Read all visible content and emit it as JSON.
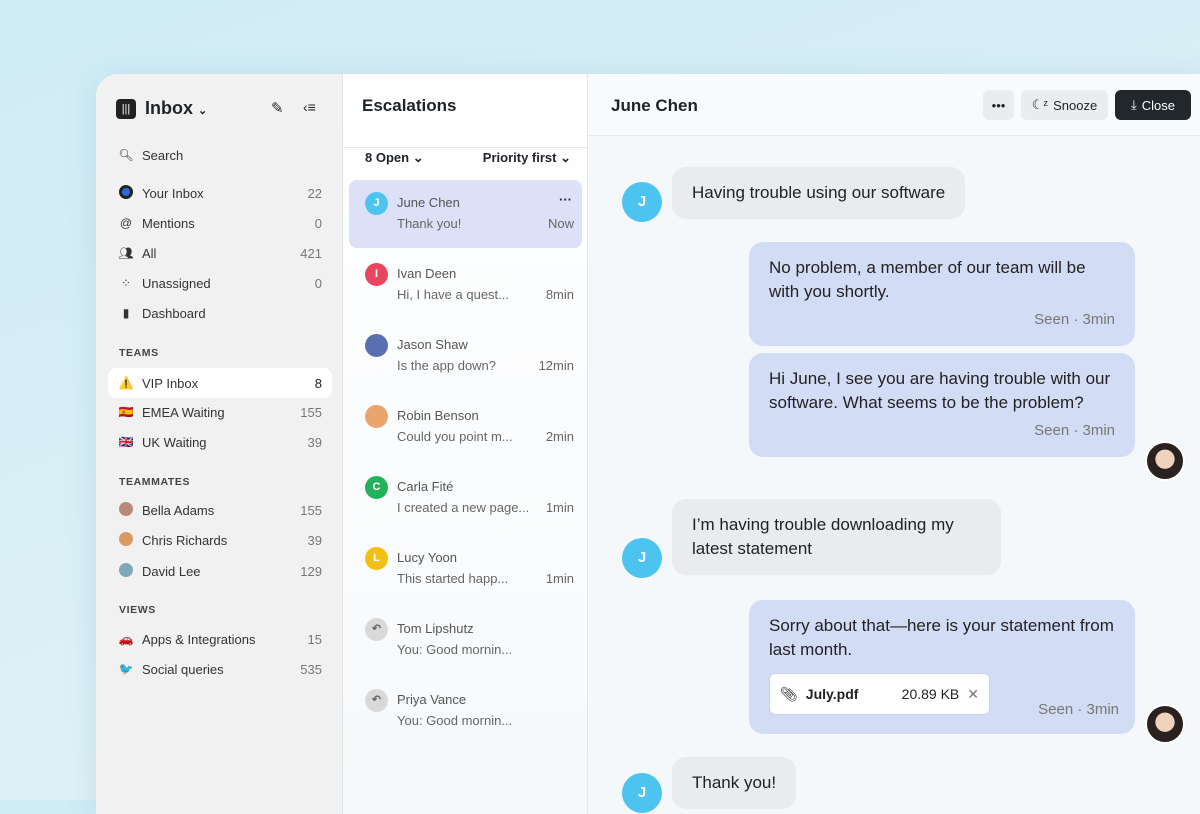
{
  "sidebar": {
    "title": "Inbox",
    "search": "Search",
    "items": [
      {
        "label": "Your Inbox",
        "count": "22"
      },
      {
        "label": "Mentions",
        "count": "0"
      },
      {
        "label": "All",
        "count": "421"
      },
      {
        "label": "Unassigned",
        "count": "0"
      },
      {
        "label": "Dashboard",
        "count": ""
      }
    ],
    "teams_heading": "TEAMS",
    "teams": [
      {
        "label": "VIP Inbox",
        "count": "8",
        "icon": "⚠️"
      },
      {
        "label": "EMEA Waiting",
        "count": "155",
        "icon": "🇪🇸"
      },
      {
        "label": "UK Waiting",
        "count": "39",
        "icon": "🇬🇧"
      }
    ],
    "teammates_heading": "TEAMMATES",
    "teammates": [
      {
        "label": "Bella Adams",
        "count": "155"
      },
      {
        "label": "Chris Richards",
        "count": "39"
      },
      {
        "label": "David Lee",
        "count": "129"
      }
    ],
    "views_heading": "VIEWS",
    "views": [
      {
        "label": "Apps & Integrations",
        "count": "15",
        "icon": "🚗"
      },
      {
        "label": "Social queries",
        "count": "535",
        "icon": "🐦"
      }
    ]
  },
  "list": {
    "title": "Escalations",
    "filter": "8 Open",
    "sort": "Priority first",
    "conversations": [
      {
        "name": "June Chen",
        "preview": "Thank you!",
        "time": "Now",
        "initial": "J",
        "color": "#4cc4ef"
      },
      {
        "name": "Ivan Deen",
        "preview": "Hi, I have a quest...",
        "time": "8min",
        "initial": "I",
        "color": "#e9455f"
      },
      {
        "name": "Jason Shaw",
        "preview": "Is the app down?",
        "time": "12min",
        "initial": "",
        "color": "#5a6fb0"
      },
      {
        "name": "Robin Benson",
        "preview": "Could you point m...",
        "time": "2min",
        "initial": "",
        "color": "#e8a66c"
      },
      {
        "name": "Carla Fité",
        "preview": "I created a new page...",
        "time": "1min",
        "initial": "C",
        "color": "#23b15b"
      },
      {
        "name": "Lucy Yoon",
        "preview": "This started happ...",
        "time": "1min",
        "initial": "L",
        "color": "#f2c012"
      },
      {
        "name": "Tom Lipshutz",
        "preview": "You: Good mornin...",
        "time": "",
        "initial": "↶",
        "color": "#d9d9d9"
      },
      {
        "name": "Priya Vance",
        "preview": "You: Good mornin...",
        "time": "",
        "initial": "↶",
        "color": "#d9d9d9"
      }
    ]
  },
  "conversation": {
    "title": "June Chen",
    "snooze": "Snooze",
    "close": "Close",
    "messages": [
      {
        "text": "Having trouble using our software"
      },
      {
        "text": "No problem, a member of our team will be with you shortly.",
        "status": "Seen · 3min"
      },
      {
        "text": "Hi June, I see you are having trouble with our software. What seems to be the problem?",
        "status": "Seen · 3min"
      },
      {
        "text": "I’m having trouble downloading my latest statement"
      },
      {
        "text": "Sorry about that—here is your statement from last month.",
        "status": "Seen · 3min",
        "attachment": {
          "name": "July.pdf",
          "size": "20.89 KB"
        }
      },
      {
        "text": "Thank you!"
      }
    ],
    "customer_initial": "J"
  }
}
